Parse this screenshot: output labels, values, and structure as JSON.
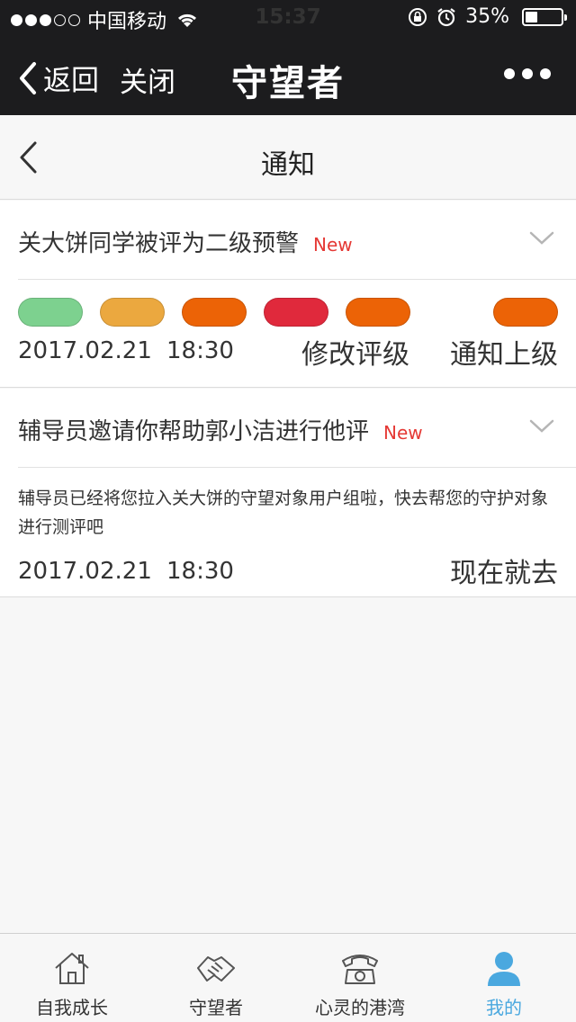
{
  "status_bar": {
    "carrier": "中国移动",
    "time": "15:37",
    "battery": "35%",
    "battery_level": 0.35
  },
  "nav": {
    "back_label": "返回",
    "close_label": "关闭",
    "title": "守望者"
  },
  "page": {
    "title": "通知"
  },
  "notifications": [
    {
      "title": "关大饼同学被评为二级预警",
      "badge": "New",
      "levels": [
        {
          "color": "#7dd18f"
        },
        {
          "color": "#eba83f"
        },
        {
          "color": "#ec6306"
        },
        {
          "color": "#e0293c"
        },
        {
          "color": "#ec6306"
        },
        {
          "color": "#ec6306"
        }
      ],
      "date": "2017.02.21",
      "time": "18:30",
      "action_primary": "修改评级",
      "action_secondary": "通知上级"
    },
    {
      "title": "辅导员邀请你帮助郭小洁进行他评",
      "badge": "New",
      "description": "辅导员已经将您拉入关大饼的守望对象用户组啦，快去帮您的守护对象进行测评吧",
      "date": "2017.02.21",
      "time": "18:30",
      "action": "现在就去"
    }
  ],
  "tabs": [
    {
      "label": "自我成长",
      "icon": "house-icon"
    },
    {
      "label": "守望者",
      "icon": "handshake-icon"
    },
    {
      "label": "心灵的港湾",
      "icon": "telephone-icon"
    },
    {
      "label": "我的",
      "icon": "user-icon",
      "active": true
    }
  ],
  "colors": {
    "accent": "#4aa8df",
    "new_badge": "#e53935",
    "header_bg": "#1c1c1e"
  }
}
